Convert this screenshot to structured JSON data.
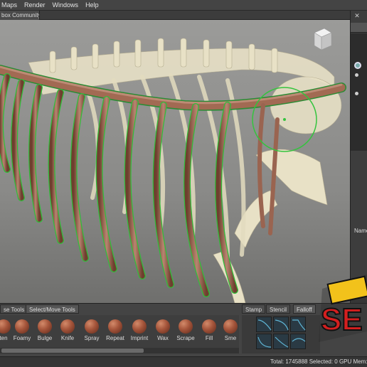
{
  "menubar": {
    "items": [
      "Maps",
      "Render",
      "Windows",
      "Help"
    ]
  },
  "tabs": {
    "document_tab": "box Community"
  },
  "right_panel": {
    "close_glyph": "✕",
    "name_label": "Name"
  },
  "bottom": {
    "tabs": [
      "se Tools",
      "Select/Move Tools",
      "Stamp",
      "Stencil",
      "Falloff"
    ],
    "brushes": [
      "ten",
      "Foamy",
      "Bulge",
      "Knife",
      "Spray",
      "Repeat",
      "Imprint",
      "Wax",
      "Scrape",
      "Fill",
      "Sme"
    ]
  },
  "statusbar": {
    "text": "Total: 1745888  Selected: 0 GPU Mem: 1"
  },
  "logo": {
    "text": "SE"
  },
  "colors": {
    "accent_tab": "#5a5a5a",
    "curve_outline": "#2fbf3a",
    "rib_fill": "#8c5a45",
    "bone": "#e6dfc2"
  },
  "icons": {
    "view_cube": "view-cube-icon",
    "eye": "eye-icon",
    "close": "close-icon"
  }
}
